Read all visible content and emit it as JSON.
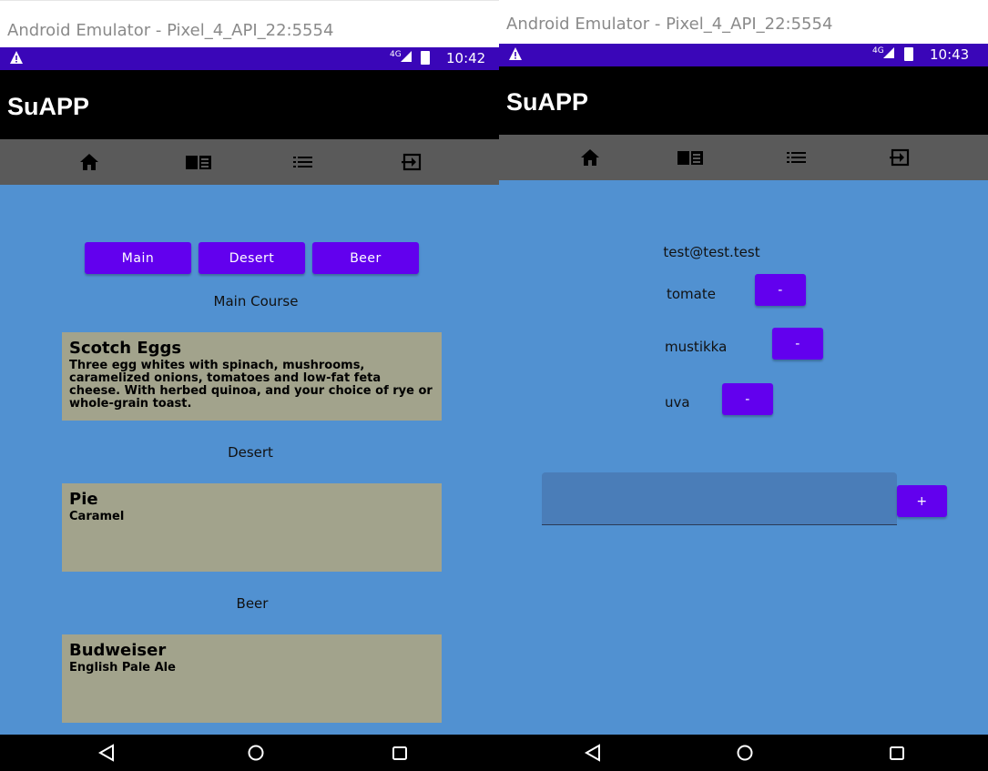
{
  "left": {
    "window_title": "Android Emulator - Pixel_4_API_22:5554",
    "status": {
      "network": "4G",
      "time": "10:42"
    },
    "app_title": "SuAPP",
    "tabs": [
      {
        "icon": "home-icon"
      },
      {
        "icon": "book-icon"
      },
      {
        "icon": "list-icon"
      },
      {
        "icon": "logout-icon"
      }
    ],
    "category_buttons": [
      "Main",
      "Desert",
      "Beer"
    ],
    "sections": [
      {
        "label": "Main Course",
        "card_title": "Scotch Eggs",
        "card_desc": "Three egg whites with spinach, mushrooms, caramelized onions, tomatoes and low-fat feta cheese. With herbed quinoa, and your choice of rye or whole-grain toast."
      },
      {
        "label": "Desert",
        "card_title": "Pie",
        "card_desc": "Caramel"
      },
      {
        "label": "Beer",
        "card_title": "Budweiser",
        "card_desc": "English Pale Ale"
      }
    ]
  },
  "right": {
    "window_title": "Android Emulator - Pixel_4_API_22:5554",
    "status": {
      "network": "4G",
      "time": "10:43"
    },
    "app_title": "SuAPP",
    "email": "test@test.test",
    "items": [
      {
        "name": "tomate",
        "button": "-"
      },
      {
        "name": "mustikka",
        "button": "-"
      },
      {
        "name": "uva",
        "button": "-"
      }
    ],
    "add_input": {
      "value": "",
      "placeholder": ""
    },
    "add_button": "+"
  },
  "colors": {
    "status_bar": "#3a06b8",
    "app_bar": "#000000",
    "tab_bar": "#5a5a5a",
    "content_bg": "#5191d1",
    "accent_button": "#6200ee",
    "card_bg": "#a2a38c"
  }
}
